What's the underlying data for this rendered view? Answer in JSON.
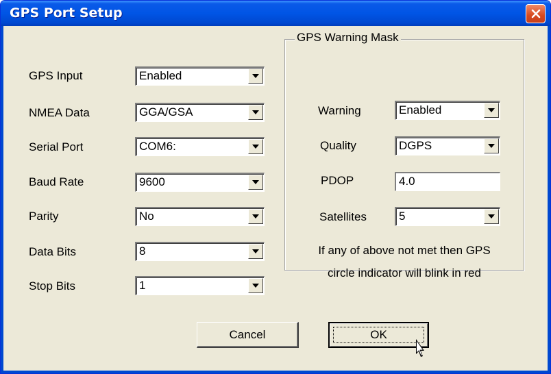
{
  "window": {
    "title": "GPS Port Setup"
  },
  "left": [
    {
      "label": "GPS Input",
      "value": "Enabled"
    },
    {
      "label": "NMEA Data",
      "value": "GGA/GSA"
    },
    {
      "label": "Serial Port",
      "value": "COM6:"
    },
    {
      "label": "Baud Rate",
      "value": "9600"
    },
    {
      "label": "Parity",
      "value": "No"
    },
    {
      "label": "Data Bits",
      "value": "8"
    },
    {
      "label": "Stop Bits",
      "value": "1"
    }
  ],
  "warning_mask": {
    "title": "GPS Warning Mask",
    "warning": {
      "label": "Warning",
      "value": "Enabled"
    },
    "quality": {
      "label": "Quality",
      "value": "DGPS"
    },
    "pdop": {
      "label": "PDOP",
      "value": "4.0"
    },
    "satellites": {
      "label": "Satellites",
      "value": "5"
    },
    "note_line1": "If any of above not met then GPS",
    "note_line2": "circle indicator will blink in red"
  },
  "buttons": {
    "cancel": "Cancel",
    "ok": "OK"
  },
  "colors": {
    "titlebar": "#0055e5",
    "close": "#d64a1f",
    "dialog_bg": "#ece9d8"
  },
  "icons": {
    "close": "close-icon",
    "dropdown": "chevron-down-icon",
    "cursor": "mouse-pointer-icon"
  }
}
